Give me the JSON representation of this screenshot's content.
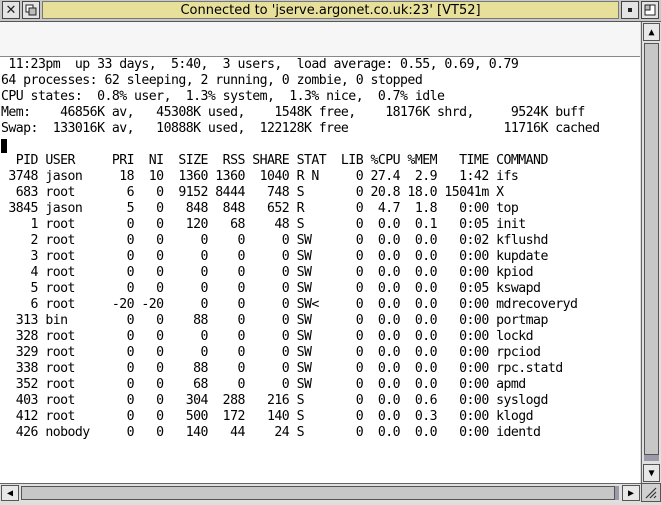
{
  "window": {
    "title": "Connected to 'jserve.argonet.co.uk:23' [VT52]"
  },
  "icons": {
    "close": "close-icon",
    "back": "back-icon",
    "iconise": "iconise-icon",
    "toggle_size": "toggle-size-icon",
    "scroll_up": "arrow-up-icon",
    "scroll_down": "arrow-down-icon",
    "scroll_left": "arrow-left-icon",
    "scroll_right": "arrow-right-icon",
    "resize": "resize-icon"
  },
  "colors": {
    "title_bar_focus": "#e7e09a",
    "terminal_bg": "#ffffff",
    "terminal_fg": "#000000",
    "scroll_track": "#9a9aa8"
  },
  "terminal": {
    "summary": [
      " 11:23pm  up 33 days,  5:40,  3 users,  load average: 0.55, 0.69, 0.79",
      "64 processes: 62 sleeping, 2 running, 0 zombie, 0 stopped",
      "CPU states:  0.8% user,  1.3% system,  1.3% nice,  0.7% idle",
      "Mem:    46856K av,   45308K used,    1548K free,    18176K shrd,     9524K buff",
      "Swap:  133016K av,   10888K used,  122128K free                     11716K cached"
    ],
    "header": "  PID USER     PRI  NI  SIZE  RSS SHARE STAT  LIB %CPU %MEM   TIME COMMAND",
    "rows": [
      " 3748 jason     18  10  1360 1360  1040 R N     0 27.4  2.9   1:42 ifs",
      "  683 root       6   0  9152 8444   748 S       0 20.8 18.0 15041m X",
      " 3845 jason      5   0   848  848   652 R       0  4.7  1.8   0:00 top",
      "    1 root       0   0   120   68    48 S       0  0.0  0.1   0:05 init",
      "    2 root       0   0     0    0     0 SW      0  0.0  0.0   0:02 kflushd",
      "    3 root       0   0     0    0     0 SW      0  0.0  0.0   0:00 kupdate",
      "    4 root       0   0     0    0     0 SW      0  0.0  0.0   0:00 kpiod",
      "    5 root       0   0     0    0     0 SW      0  0.0  0.0   0:05 kswapd",
      "    6 root     -20 -20     0    0     0 SW<     0  0.0  0.0   0:00 mdrecoveryd",
      "  313 bin        0   0    88    0     0 SW      0  0.0  0.0   0:00 portmap",
      "  328 root       0   0     0    0     0 SW      0  0.0  0.0   0:00 lockd",
      "  329 root       0   0     0    0     0 SW      0  0.0  0.0   0:00 rpciod",
      "  338 root       0   0    88    0     0 SW      0  0.0  0.0   0:00 rpc.statd",
      "  352 root       0   0    68    0     0 SW      0  0.0  0.0   0:00 apmd",
      "  403 root       0   0   304  288   216 S       0  0.0  0.6   0:00 syslogd",
      "  412 root       0   0   500  172   140 S       0  0.0  0.3   0:00 klogd",
      "  426 nobody     0   0   140   44    24 S       0  0.0  0.0   0:00 identd"
    ]
  }
}
